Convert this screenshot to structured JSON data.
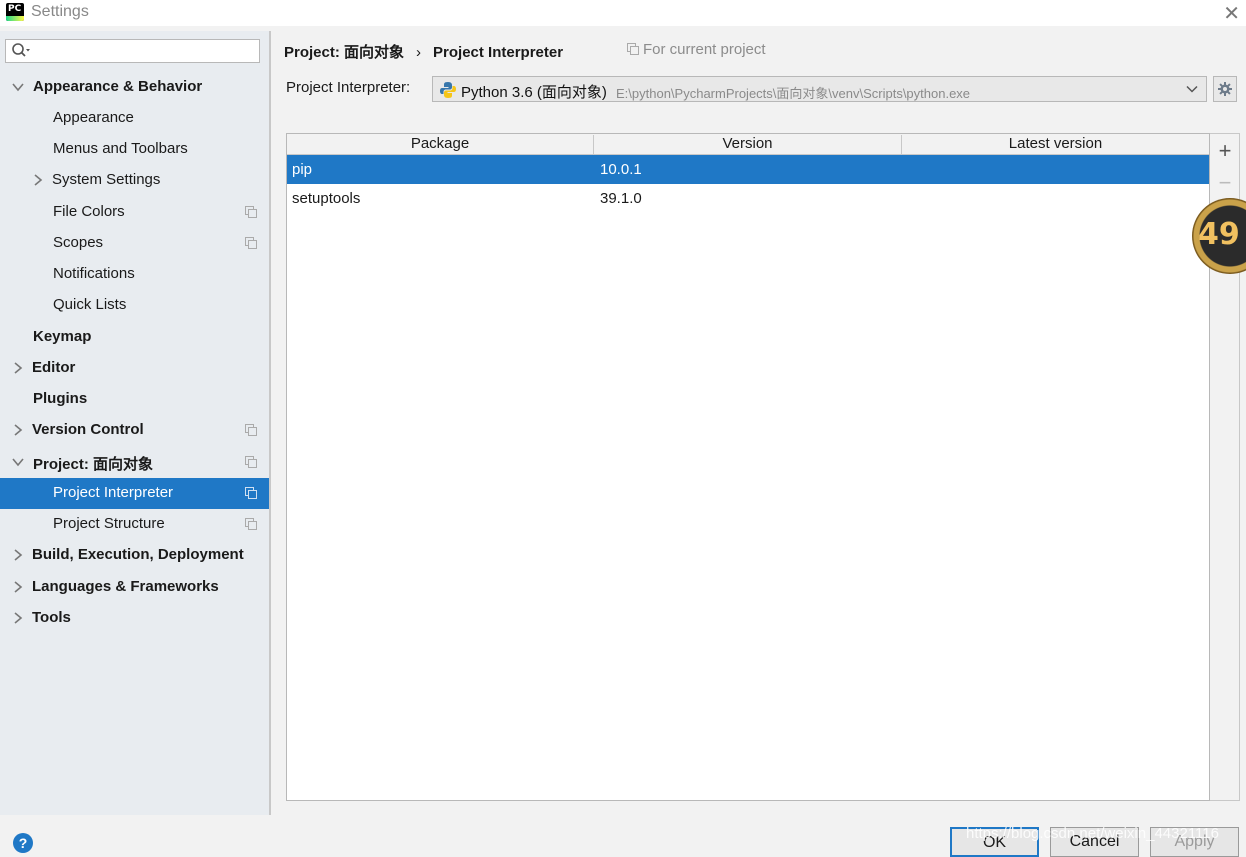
{
  "window": {
    "title": "Settings",
    "app_logo_text": "PC"
  },
  "search": {
    "placeholder": "",
    "value": ""
  },
  "sidebar": {
    "items": [
      {
        "label": "Appearance & Behavior"
      },
      {
        "label": "Appearance"
      },
      {
        "label": "Menus and Toolbars"
      },
      {
        "label": "System Settings"
      },
      {
        "label": "File Colors"
      },
      {
        "label": "Scopes"
      },
      {
        "label": "Notifications"
      },
      {
        "label": "Quick Lists"
      },
      {
        "label": "Keymap"
      },
      {
        "label": "Editor"
      },
      {
        "label": "Plugins"
      },
      {
        "label": "Version Control"
      },
      {
        "label": "Project: 面向对象"
      },
      {
        "label": "Project Interpreter"
      },
      {
        "label": "Project Structure"
      },
      {
        "label": "Build, Execution, Deployment"
      },
      {
        "label": "Languages & Frameworks"
      },
      {
        "label": "Tools"
      }
    ]
  },
  "breadcrumb": {
    "parent": "Project: 面向对象",
    "separator": "›",
    "current": "Project Interpreter"
  },
  "scope_note": "For current project",
  "interpreter": {
    "label": "Project Interpreter:",
    "name": "Python 3.6 (面向对象)",
    "path": "E:\\python\\PycharmProjects\\面向对象\\venv\\Scripts\\python.exe"
  },
  "packages": {
    "columns": [
      "Package",
      "Version",
      "Latest version"
    ],
    "rows": [
      {
        "package": "pip",
        "version": "10.0.1",
        "latest": ""
      },
      {
        "package": "setuptools",
        "version": "39.1.0",
        "latest": ""
      }
    ],
    "selected_row": 0
  },
  "tools": {
    "add_label": "+",
    "remove_label": "−"
  },
  "overlay_badge": "49",
  "footer": {
    "help_label": "?",
    "ok_label": "OK",
    "cancel_label": "Cancel",
    "apply_label": "Apply",
    "watermark": "https://blog.csdn.net/weixin_44321116"
  },
  "colors": {
    "selection": "#1f78c6",
    "sidebar_bg": "#e8ecf0",
    "window_bg": "#f2f2f2"
  }
}
